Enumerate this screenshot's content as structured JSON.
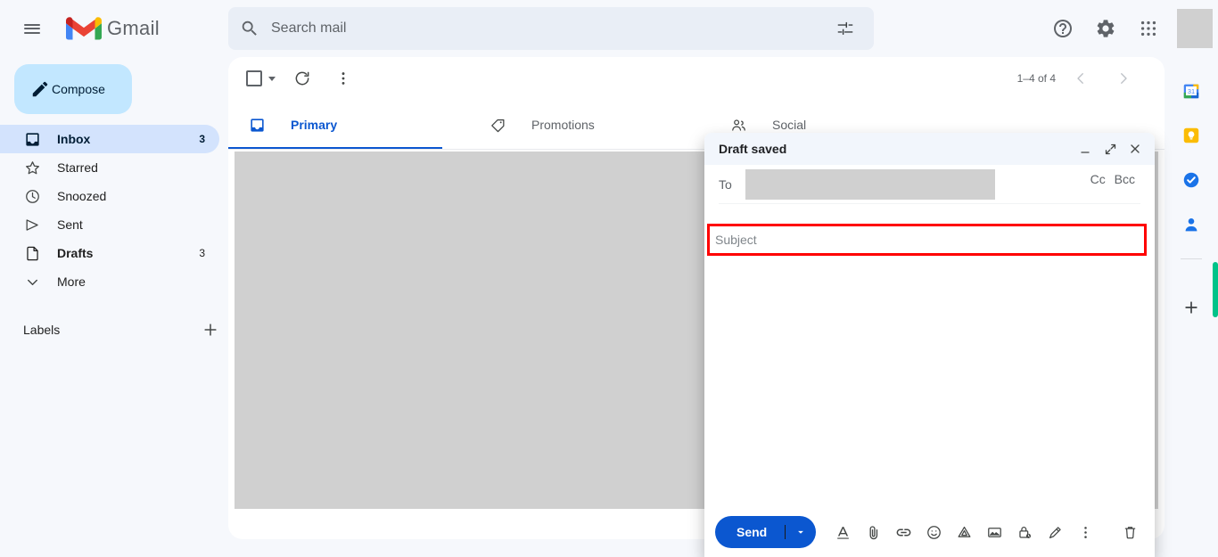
{
  "app": {
    "name": "Gmail",
    "menu_icon": "hamburger-menu-icon",
    "logo_icon": "gmail-logo-icon"
  },
  "search": {
    "placeholder": "Search mail",
    "value": "",
    "icon": "search-icon",
    "filter_icon": "search-options-icon"
  },
  "top_right": {
    "help_label": "?",
    "help_icon": "help-icon",
    "settings_icon": "gear-icon",
    "apps_icon": "google-apps-grid-icon",
    "avatar_icon": "avatar"
  },
  "sidebar": {
    "compose_label": "Compose",
    "compose_icon": "pencil-icon",
    "items": [
      {
        "label": "Inbox",
        "count": "3",
        "icon": "inbox-icon",
        "active": true
      },
      {
        "label": "Starred",
        "count": "",
        "icon": "star-icon",
        "active": false
      },
      {
        "label": "Snoozed",
        "count": "",
        "icon": "clock-icon",
        "active": false
      },
      {
        "label": "Sent",
        "count": "",
        "icon": "send-icon",
        "active": false
      },
      {
        "label": "Drafts",
        "count": "3",
        "icon": "draft-icon",
        "active": false
      },
      {
        "label": "More",
        "count": "",
        "icon": "chevron-down-icon",
        "active": false
      }
    ],
    "labels_title": "Labels",
    "labels_add_icon": "plus-icon"
  },
  "list_toolbar": {
    "select_all_icon": "checkbox-icon",
    "select_all_caret_icon": "chevron-down-icon",
    "refresh_icon": "refresh-icon",
    "more_icon": "more-vertical-icon",
    "pagination": "1–4 of 4",
    "prev_icon": "chevron-left-icon",
    "next_icon": "chevron-right-icon"
  },
  "tabs": [
    {
      "label": "Primary",
      "icon": "inbox-tab-icon",
      "active": true
    },
    {
      "label": "Promotions",
      "icon": "tag-icon",
      "active": false
    },
    {
      "label": "Social",
      "icon": "people-icon",
      "active": false
    }
  ],
  "right_rail": {
    "items": [
      {
        "name": "google-calendar-icon"
      },
      {
        "name": "google-keep-icon"
      },
      {
        "name": "google-tasks-icon"
      },
      {
        "name": "google-contacts-icon"
      }
    ],
    "add_icon": "plus-icon"
  },
  "compose": {
    "title": "Draft saved",
    "minimize_icon": "minimize-icon",
    "expand_icon": "expand-icon",
    "close_icon": "close-icon",
    "to_label": "To",
    "to_value": "",
    "cc_label": "Cc",
    "bcc_label": "Bcc",
    "subject_placeholder": "Subject",
    "subject_value": "",
    "body_value": "",
    "send_label": "Send",
    "send_caret_icon": "chevron-down-icon",
    "toolbar_icons": [
      {
        "name": "formatting-options-icon"
      },
      {
        "name": "attach-file-icon"
      },
      {
        "name": "insert-link-icon"
      },
      {
        "name": "insert-emoji-icon"
      },
      {
        "name": "insert-drive-icon"
      },
      {
        "name": "insert-photo-icon"
      },
      {
        "name": "confidential-mode-icon"
      },
      {
        "name": "insert-signature-icon"
      },
      {
        "name": "more-options-icon"
      }
    ],
    "discard_icon": "trash-icon"
  },
  "colors": {
    "accent": "#0b57d0",
    "compose_bg": "#c2e7ff",
    "active_nav": "#d3e3fd",
    "highlight_border": "#ff0000",
    "redacted": "#d0d0d0",
    "rail_green": "#00c389"
  }
}
